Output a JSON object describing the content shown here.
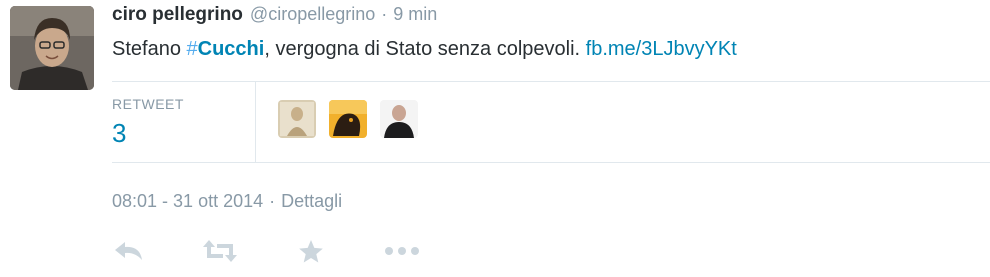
{
  "tweet": {
    "fullname": "ciro pellegrino",
    "username": "@ciropellegrino",
    "separator": "·",
    "time": "9 min",
    "text_before": "Stefano ",
    "hashtag_symbol": "#",
    "hashtag_word": "Cucchi",
    "text_middle": ", vergogna di Stato senza colpevoli. ",
    "link": "fb.me/3LJbvyYKt"
  },
  "stats": {
    "retweet_label": "RETWEET",
    "retweet_count": "3"
  },
  "meta": {
    "timestamp": "08:01 - 31 ott 2014",
    "separator": "·",
    "details": "Dettagli"
  },
  "actions": {
    "reply_icon": "reply-icon",
    "retweet_icon": "retweet-icon",
    "favorite_icon": "star-icon",
    "more_icon": "more-icon"
  },
  "colors": {
    "name": "#292f33",
    "muted": "#8899a6",
    "link": "#0084b4",
    "hashtag_symbol": "#55acee",
    "divider": "#e1e8ed",
    "action_icons": "#ccd6dd"
  }
}
